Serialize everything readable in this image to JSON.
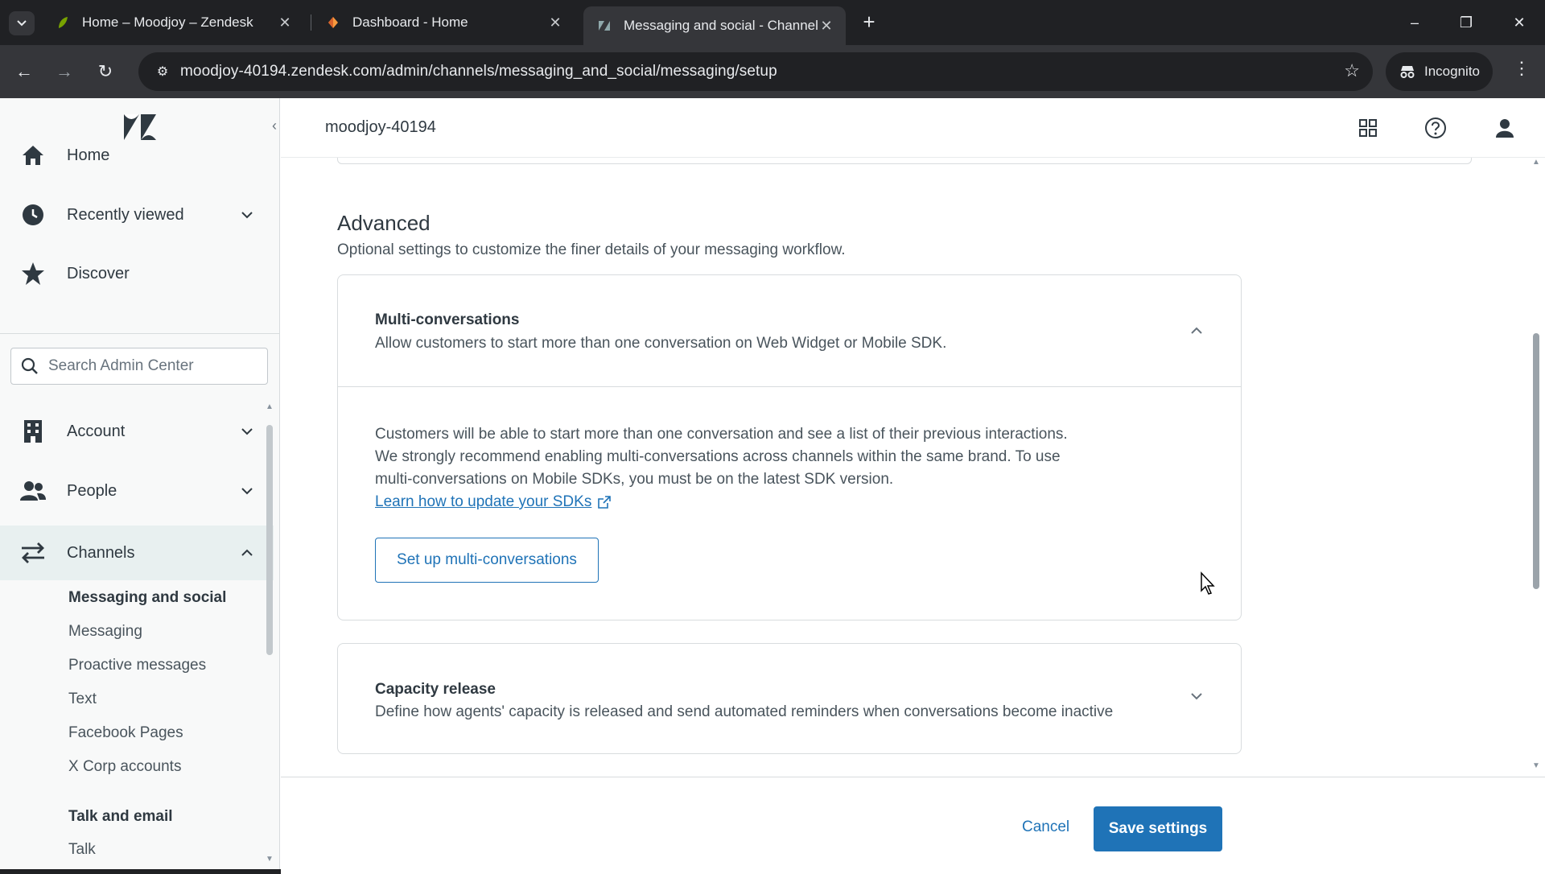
{
  "browser": {
    "tabs": [
      {
        "title": "Home – Moodjoy – Zendesk",
        "favicon": "zendesk-leaf-icon",
        "color": "#78a300"
      },
      {
        "title": "Dashboard - Home",
        "favicon": "dashboard-icon",
        "color": "#f79a3e"
      },
      {
        "title": "Messaging and social - Channels",
        "favicon": "zendesk-admin-icon",
        "color": "#17494d"
      }
    ],
    "url": "moodjoy-40194.zendesk.com/admin/channels/messaging_and_social/messaging/setup",
    "incognito_label": "Incognito"
  },
  "sidebar": {
    "nav_top": [
      {
        "label": "Home",
        "icon": "home-icon"
      },
      {
        "label": "Recently viewed",
        "icon": "clock-icon"
      },
      {
        "label": "Discover",
        "icon": "star-icon"
      }
    ],
    "search_placeholder": "Search Admin Center",
    "nav_main": [
      {
        "label": "Account",
        "icon": "building-icon"
      },
      {
        "label": "People",
        "icon": "people-icon"
      },
      {
        "label": "Channels",
        "icon": "channels-icon"
      }
    ],
    "channels_sub": {
      "group1": "Messaging and social",
      "items": [
        "Messaging",
        "Proactive messages",
        "Text",
        "Facebook Pages",
        "X Corp accounts"
      ],
      "group2": "Talk and email",
      "items2": [
        "Talk"
      ]
    }
  },
  "header": {
    "account": "moodjoy-40194"
  },
  "main": {
    "section_title": "Advanced",
    "section_desc": "Optional settings to customize the finer details of your messaging workflow.",
    "multi": {
      "title": "Multi-conversations",
      "desc": "Allow customers to start more than one conversation on Web Widget or Mobile SDK.",
      "body_lines": [
        "Customers will be able to start more than one conversation and see a list of their previous interactions.",
        "We strongly recommend enabling multi-conversations across channels within the same brand. To use",
        "multi-conversations on Mobile SDKs, you must be on the latest SDK version."
      ],
      "link": "Learn how to update your SDKs",
      "button": "Set up multi-conversations"
    },
    "capacity": {
      "title": "Capacity release",
      "desc": "Define how agents' capacity is released and send automated reminders when conversations become inactive"
    }
  },
  "footer": {
    "cancel": "Cancel",
    "save": "Save settings"
  },
  "colors": {
    "brand_blue": "#1f73b7",
    "active_nav_bg": "#e8f0f0"
  }
}
